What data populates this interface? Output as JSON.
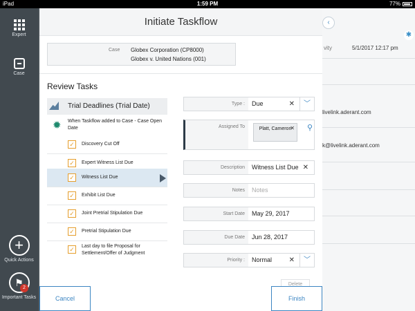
{
  "status_bar": {
    "device": "iPad",
    "time": "1:59 PM",
    "battery": "77%"
  },
  "sidebar": {
    "expert_label": "Expert",
    "case_label": "Case",
    "quick_actions_label": "Quick Actions",
    "important_tasks_label": "Important Tasks",
    "important_tasks_badge": "2"
  },
  "background": {
    "activity_label": "vity",
    "activity_time": "5/1/2017 12:17 pm",
    "email1": "livelink.aderant.com",
    "email2": "k@livelink.aderant.com"
  },
  "modal": {
    "title": "Initiate Taskflow",
    "case_label": "Case",
    "case_line1": "Globex Corporation (CP8000)",
    "case_line2": "Globex v. United Nations (001)",
    "review_title": "Review Tasks",
    "group_label": "Trial Deadlines (Trial Date)",
    "trigger_text": "When Taskflow added to Case - Case Open Date",
    "tasks": [
      {
        "label": "Discovery Cut Off"
      },
      {
        "label": "Expert Witness List Due"
      },
      {
        "label": "Witness List Due"
      },
      {
        "label": "Exhibit List Due"
      },
      {
        "label": "Joint Pretrial Stipulation Due"
      },
      {
        "label": "Pretrial Stipulation Due"
      },
      {
        "label": "Last day to file Proposal for Settlement/Offer of Judgment"
      }
    ],
    "form": {
      "type_label": "Type :",
      "type_value": "Due",
      "assigned_label": "Assigned To",
      "assigned_value": "Platt, Cameron",
      "description_label": "Description",
      "description_value": "Witness List Due",
      "notes_label": "Notes",
      "notes_placeholder": "Notes",
      "start_label": "Start Date",
      "start_value": "May 29, 2017",
      "due_label": "Due Date",
      "due_value": "Jun 28, 2017",
      "priority_label": "Priority :",
      "priority_value": "Normal"
    },
    "more_label": "Delete",
    "cancel_label": "Cancel",
    "finish_label": "Finish"
  }
}
